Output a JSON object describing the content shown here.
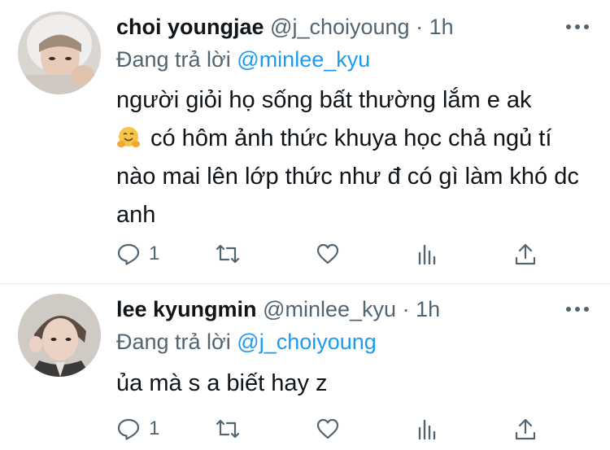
{
  "tweets": [
    {
      "name": "choi youngjae",
      "handle": "@j_choiyoung",
      "dot": "·",
      "time": "1h",
      "reply_prefix": "Đang trả lời",
      "reply_to": "@minlee_kyu",
      "text_line1": "người giỏi họ sống bất thường lắm e ak",
      "emoji": "hugging-face-icon",
      "text_rest": "có hôm ảnh thức khuya học chả ngủ tí nào mai lên lớp thức như đ có gì làm khó dc anh",
      "reply_count": "1"
    },
    {
      "name": "lee kyungmin",
      "handle": "@minlee_kyu",
      "dot": "·",
      "time": "1h",
      "reply_prefix": "Đang trả lời",
      "reply_to": "@j_choiyoung",
      "text": "ủa mà s a biết hay z",
      "reply_count": "1"
    }
  ],
  "colors": {
    "text": "#0f1419",
    "secondary": "#536471",
    "accent": "#1d9bf0",
    "divider": "#e7e9ea"
  }
}
